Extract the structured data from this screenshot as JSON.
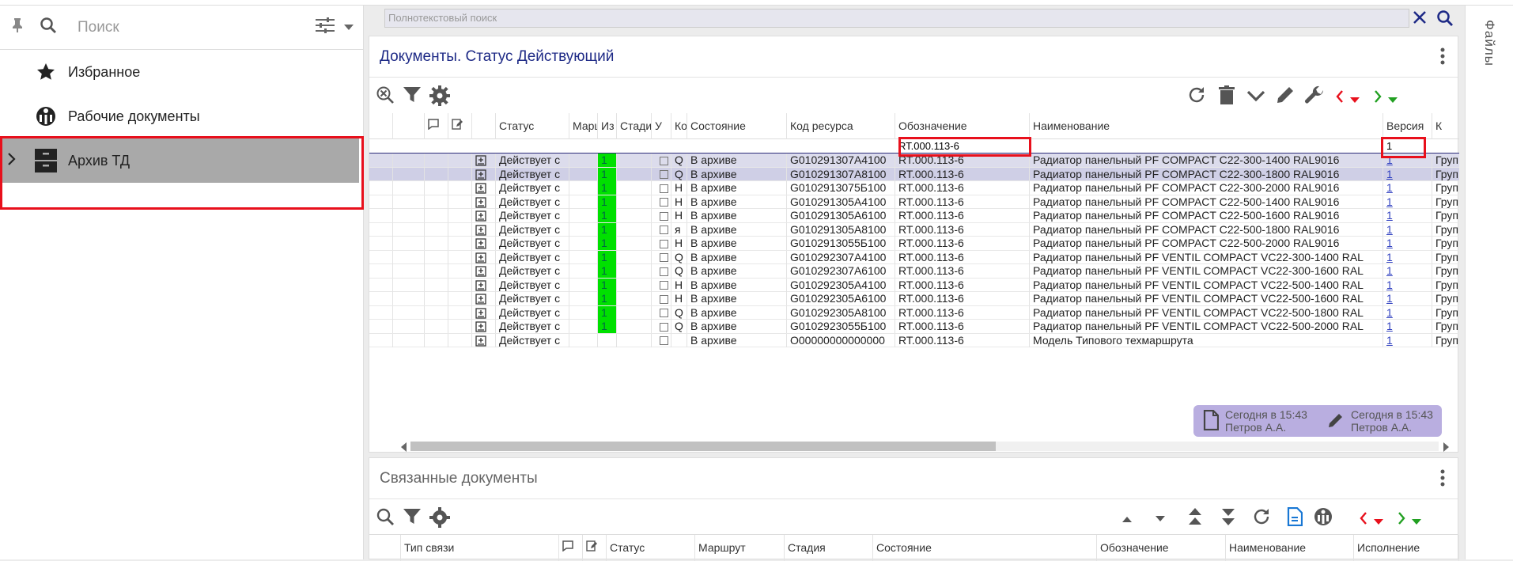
{
  "sidebar": {
    "search_placeholder": "Поиск",
    "items": [
      {
        "label": "Избранное",
        "icon": "star-icon"
      },
      {
        "label": "Рабочие документы",
        "icon": "workflow-icon"
      },
      {
        "label": "Архив ТД",
        "icon": "archive-cabinet-icon",
        "selected": true
      }
    ]
  },
  "fulltext_search": {
    "placeholder": "Полнотекстовый поиск"
  },
  "right_strip": {
    "label": "Файлы"
  },
  "main_panel": {
    "title": "Документы. Статус Действующий",
    "columns": [
      "",
      "",
      "",
      "",
      "",
      "Статус",
      "Марш",
      "Из",
      "Стади",
      "У",
      "Ко",
      "Состояние",
      "Код ресурса",
      "Обозначение",
      "Наименование",
      "Версия",
      "К"
    ],
    "filters": {
      "designation": "RT.000.113-6",
      "version": "1"
    },
    "rows": [
      {
        "status": "Действует с",
        "route": "1",
        "ko": "Q",
        "state": "В архиве",
        "code": "G010291307A4100",
        "designation": "RT.000.113-6",
        "name": "Радиатор панельный PF COMPACT C22-300-1400 RAL9016",
        "version": "1",
        "k": "Груп"
      },
      {
        "status": "Действует с",
        "route": "1",
        "ko": "Q",
        "state": "В архиве",
        "code": "G010291307A8100",
        "designation": "RT.000.113-6",
        "name": "Радиатор панельный PF COMPACT C22-300-1800 RAL9016",
        "version": "1",
        "k": "Груп"
      },
      {
        "status": "Действует с",
        "route": "1",
        "ko": "Н",
        "state": "В архиве",
        "code": "G0102913075Б100",
        "designation": "RT.000.113-6",
        "name": "Радиатор панельный PF COMPACT C22-300-2000 RAL9016",
        "version": "1",
        "k": "Груп"
      },
      {
        "status": "Действует с",
        "route": "1",
        "ko": "Н",
        "state": "В архиве",
        "code": "G010291305A4100",
        "designation": "RT.000.113-6",
        "name": "Радиатор панельный PF COMPACT C22-500-1400 RAL9016",
        "version": "1",
        "k": "Груп"
      },
      {
        "status": "Действует с",
        "route": "1",
        "ko": "Н",
        "state": "В архиве",
        "code": "G010291305A6100",
        "designation": "RT.000.113-6",
        "name": "Радиатор панельный PF COMPACT C22-500-1600 RAL9016",
        "version": "1",
        "k": "Груп"
      },
      {
        "status": "Действует с",
        "route": "1",
        "ko": "я",
        "state": "В архиве",
        "code": "G010291305A8100",
        "designation": "RT.000.113-6",
        "name": "Радиатор панельный PF COMPACT C22-500-1800 RAL9016",
        "version": "1",
        "k": "Груп"
      },
      {
        "status": "Действует с",
        "route": "1",
        "ko": "Н",
        "state": "В архиве",
        "code": "G0102913055Б100",
        "designation": "RT.000.113-6",
        "name": "Радиатор панельный PF COMPACT C22-500-2000 RAL9016",
        "version": "1",
        "k": "Груп"
      },
      {
        "status": "Действует с",
        "route": "1",
        "ko": "Q",
        "state": "В архиве",
        "code": "G010292307A4100",
        "designation": "RT.000.113-6",
        "name": "Радиатор панельный PF VENTIL COMPACT VC22-300-1400 RAL",
        "version": "1",
        "k": "Груп"
      },
      {
        "status": "Действует с",
        "route": "1",
        "ko": "Q",
        "state": "В архиве",
        "code": "G010292307A6100",
        "designation": "RT.000.113-6",
        "name": "Радиатор панельный PF VENTIL COMPACT VC22-300-1600 RAL",
        "version": "1",
        "k": "Груп"
      },
      {
        "status": "Действует с",
        "route": "1",
        "ko": "Н",
        "state": "В архиве",
        "code": "G010292305A4100",
        "designation": "RT.000.113-6",
        "name": "Радиатор панельный PF VENTIL COMPACT VC22-500-1400 RAL",
        "version": "1",
        "k": "Груп"
      },
      {
        "status": "Действует с",
        "route": "1",
        "ko": "Н",
        "state": "В архиве",
        "code": "G010292305A6100",
        "designation": "RT.000.113-6",
        "name": "Радиатор панельный PF VENTIL COMPACT VC22-500-1600 RAL",
        "version": "1",
        "k": "Груп"
      },
      {
        "status": "Действует с",
        "route": "1",
        "ko": "Q",
        "state": "В архиве",
        "code": "G010292305A8100",
        "designation": "RT.000.113-6",
        "name": "Радиатор панельный PF VENTIL COMPACT VC22-500-1800 RAL",
        "version": "1",
        "k": "Груп"
      },
      {
        "status": "Действует с",
        "route": "1",
        "ko": "Q",
        "state": "В архиве",
        "code": "G0102923055Б100",
        "designation": "RT.000.113-6",
        "name": "Радиатор панельный PF VENTIL COMPACT VC22-500-2000 RAL",
        "version": "1",
        "k": "Груп"
      },
      {
        "status": "Действует с",
        "route": "",
        "ko": "",
        "state": "В архиве",
        "code": "O00000000000000",
        "designation": "RT.000.113-6",
        "name": "Модель Типового техмаршрута",
        "version": "1",
        "k": "Груп"
      }
    ],
    "chips": [
      {
        "icon": "document-icon",
        "line1": "Сегодня в 15:43",
        "line2": "Петров А.А."
      },
      {
        "icon": "pencil-icon",
        "line1": "Сегодня в 15:43",
        "line2": "Петров А.А."
      }
    ]
  },
  "related_panel": {
    "title": "Связанные документы",
    "columns": [
      "Тип связи",
      "",
      "",
      "Статус",
      "Маршрут",
      "Стадия",
      "Состояние",
      "Обозначение",
      "Наименование",
      "Исполнение"
    ]
  },
  "colors": {
    "accent": "#1e2a86",
    "highlight": "#e8101c",
    "route_green": "#00e000",
    "chip_bg": "#b9aee0"
  }
}
